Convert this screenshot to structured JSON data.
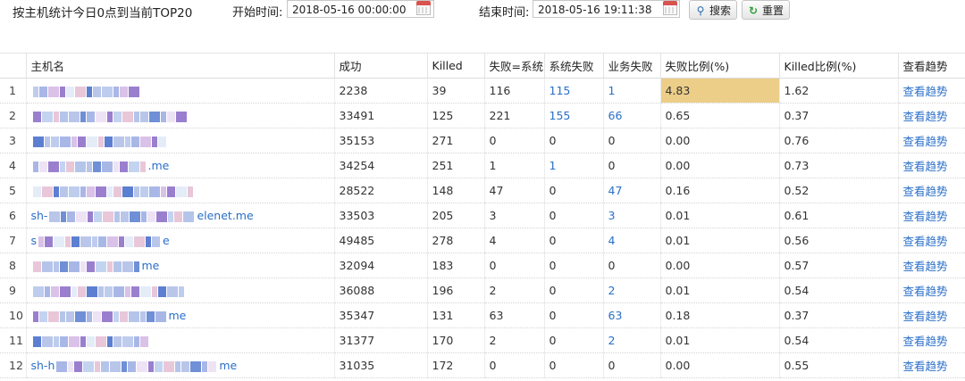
{
  "toolbar": {
    "title": "按主机统计今日0点到当前TOP20",
    "start_label": "开始时间:",
    "start_value": "2018-05-16 00:00:00",
    "end_label": "结束时间:",
    "end_value": "2018-05-16 19:11:38",
    "search_label": "搜索",
    "reset_label": "重置"
  },
  "table": {
    "headers": [
      "",
      "主机名",
      "成功",
      "Killed",
      "失败=系统+",
      "系统失败",
      "业务失败",
      "失败比例(%)",
      "Killed比例(%)",
      "查看趋势"
    ],
    "rows": [
      {
        "idx": "1",
        "host_prefix": "",
        "host_suffix": "",
        "success": "2238",
        "killed": "39",
        "fail": "116",
        "sys_fail": "115",
        "biz_fail": "1",
        "fail_ratio": "4.83",
        "killed_ratio": "1.62",
        "trend": "查看趋势"
      },
      {
        "idx": "2",
        "host_prefix": "",
        "host_suffix": "",
        "success": "33491",
        "killed": "125",
        "fail": "221",
        "sys_fail": "155",
        "biz_fail": "66",
        "fail_ratio": "0.65",
        "killed_ratio": "0.37",
        "trend": "查看趋势"
      },
      {
        "idx": "3",
        "host_prefix": "",
        "host_suffix": "",
        "success": "35153",
        "killed": "271",
        "fail": "0",
        "sys_fail": "0",
        "biz_fail": "0",
        "fail_ratio": "0.00",
        "killed_ratio": "0.76",
        "trend": "查看趋势"
      },
      {
        "idx": "4",
        "host_prefix": "",
        "host_suffix": ".me",
        "success": "34254",
        "killed": "251",
        "fail": "1",
        "sys_fail": "1",
        "biz_fail": "0",
        "fail_ratio": "0.00",
        "killed_ratio": "0.73",
        "trend": "查看趋势"
      },
      {
        "idx": "5",
        "host_prefix": "",
        "host_suffix": "",
        "success": "28522",
        "killed": "148",
        "fail": "47",
        "sys_fail": "0",
        "biz_fail": "47",
        "fail_ratio": "0.16",
        "killed_ratio": "0.52",
        "trend": "查看趋势"
      },
      {
        "idx": "6",
        "host_prefix": "sh-",
        "host_suffix": "elenet.me",
        "success": "33503",
        "killed": "205",
        "fail": "3",
        "sys_fail": "0",
        "biz_fail": "3",
        "fail_ratio": "0.01",
        "killed_ratio": "0.61",
        "trend": "查看趋势"
      },
      {
        "idx": "7",
        "host_prefix": "s",
        "host_suffix": "e",
        "success": "49485",
        "killed": "278",
        "fail": "4",
        "sys_fail": "0",
        "biz_fail": "4",
        "fail_ratio": "0.01",
        "killed_ratio": "0.56",
        "trend": "查看趋势"
      },
      {
        "idx": "8",
        "host_prefix": "",
        "host_suffix": "me",
        "success": "32094",
        "killed": "183",
        "fail": "0",
        "sys_fail": "0",
        "biz_fail": "0",
        "fail_ratio": "0.00",
        "killed_ratio": "0.57",
        "trend": "查看趋势"
      },
      {
        "idx": "9",
        "host_prefix": "",
        "host_suffix": "",
        "success": "36088",
        "killed": "196",
        "fail": "2",
        "sys_fail": "0",
        "biz_fail": "2",
        "fail_ratio": "0.01",
        "killed_ratio": "0.54",
        "trend": "查看趋势"
      },
      {
        "idx": "10",
        "host_prefix": "",
        "host_suffix": "me",
        "success": "35347",
        "killed": "131",
        "fail": "63",
        "sys_fail": "0",
        "biz_fail": "63",
        "fail_ratio": "0.18",
        "killed_ratio": "0.37",
        "trend": "查看趋势"
      },
      {
        "idx": "11",
        "host_prefix": "",
        "host_suffix": "",
        "success": "31377",
        "killed": "170",
        "fail": "2",
        "sys_fail": "0",
        "biz_fail": "2",
        "fail_ratio": "0.01",
        "killed_ratio": "0.54",
        "trend": "查看趋势"
      },
      {
        "idx": "12",
        "host_prefix": "sh-h",
        "host_suffix": "me",
        "success": "31035",
        "killed": "172",
        "fail": "0",
        "sys_fail": "0",
        "biz_fail": "0",
        "fail_ratio": "0.00",
        "killed_ratio": "0.55",
        "trend": "查看趋势"
      }
    ]
  },
  "colors": {
    "link": "#2a6fc9",
    "highlight": "#ecce88"
  },
  "icons": {
    "calendar": "calendar-icon",
    "search": "search-icon",
    "reset": "refresh-icon"
  }
}
